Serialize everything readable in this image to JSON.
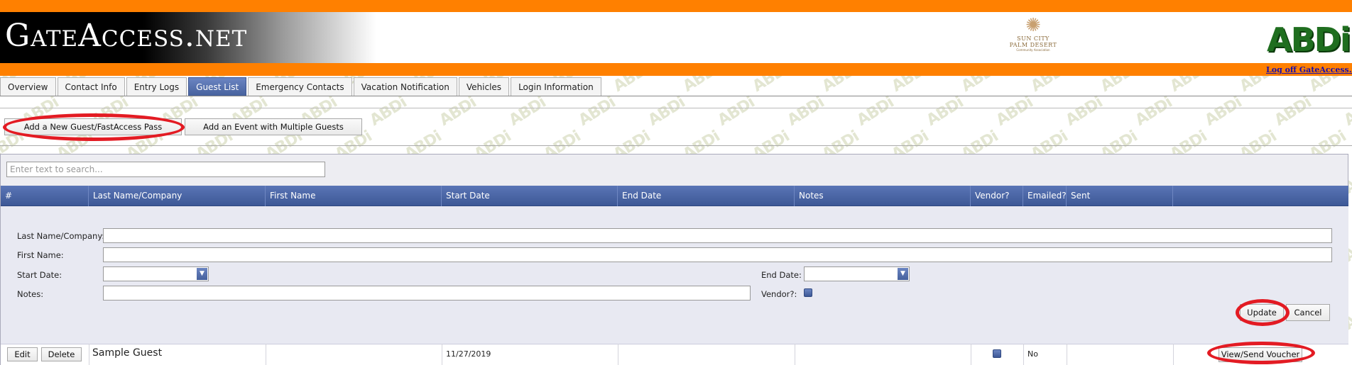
{
  "header": {
    "brand": "GateAccess.net",
    "community_logo": {
      "name_line1": "SUN CITY",
      "name_line2": "PALM DESERT",
      "tagline": "Community Association"
    },
    "vendor_logo": "ABDi",
    "logoff_link": "Log off GateAccess.net"
  },
  "tabs": [
    {
      "label": "Overview"
    },
    {
      "label": "Contact Info"
    },
    {
      "label": "Entry Logs"
    },
    {
      "label": "Guest List",
      "active": true
    },
    {
      "label": "Emergency Contacts"
    },
    {
      "label": "Vacation Notification"
    },
    {
      "label": "Vehicles"
    },
    {
      "label": "Login Information"
    }
  ],
  "actions": {
    "add_guest": "Add a New Guest/FastAccess Pass",
    "add_event": "Add an Event with Multiple Guests"
  },
  "search": {
    "placeholder": "Enter text to search..."
  },
  "table": {
    "columns": [
      "#",
      "Last Name/Company",
      "First Name",
      "Start Date",
      "End Date",
      "Notes",
      "Vendor?",
      "Emailed?",
      "Sent",
      ""
    ]
  },
  "edit_form": {
    "last_name_label": "Last Name/Company:",
    "first_name_label": "First Name:",
    "start_date_label": "Start Date:",
    "end_date_label": "End Date:",
    "notes_label": "Notes:",
    "vendor_label": "Vendor?:",
    "update_button": "Update",
    "cancel_button": "Cancel"
  },
  "rows": [
    {
      "edit": "Edit",
      "delete": "Delete",
      "last_name": "Sample Guest",
      "first_name": "",
      "start_date": "11/27/2019",
      "end_date": "",
      "notes": "",
      "vendor": true,
      "emailed": "No",
      "sent": "",
      "voucher": "View/Send Voucher"
    }
  ],
  "colors": {
    "orange": "#ff8000",
    "header_blue": "#45609c",
    "highlight_red": "#e31b23"
  }
}
